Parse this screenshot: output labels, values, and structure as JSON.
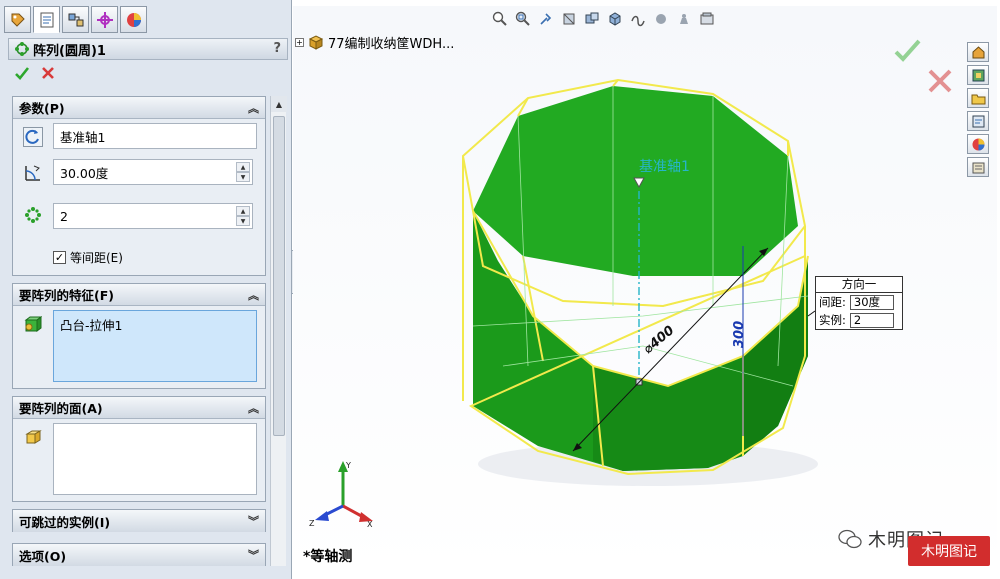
{
  "property_manager": {
    "title": "阵列(圆周)1",
    "help": "?",
    "parameters": {
      "header": "参数(P)",
      "axis": "基准轴1",
      "angle": "30.00度",
      "instances": "2",
      "equal_spacing_label": "等间距(E)",
      "equal_spacing_checked": "✓"
    },
    "features_to_pattern": {
      "header": "要阵列的特征(F)",
      "items": [
        "凸台-拉伸1"
      ]
    },
    "faces_to_pattern": {
      "header": "要阵列的面(A)"
    },
    "instances_to_skip": {
      "header": "可跳过的实例(I)"
    },
    "options": {
      "header": "选项(O)"
    }
  },
  "viewport": {
    "tree_root": "77编制收纳筐WDH...",
    "axis_label": "基准轴1",
    "dimension_diameter": "⌀400",
    "dimension_height": "300",
    "callout": {
      "title": "方向一",
      "spacing_label": "间距:",
      "spacing_value": "30度",
      "instances_label": "实例:",
      "instances_value": "2"
    },
    "view_name": "*等轴测",
    "triad": {
      "x": "X",
      "y": "Y",
      "z": "Z"
    },
    "brand": "木明图记",
    "seal": "木明图记"
  },
  "colors": {
    "model_green": "#1fa21f",
    "model_edge": "#f2e94c",
    "accept_green": "#2da72d",
    "cancel_red": "#d83a3a",
    "axis_cyan": "#26b5c9"
  }
}
